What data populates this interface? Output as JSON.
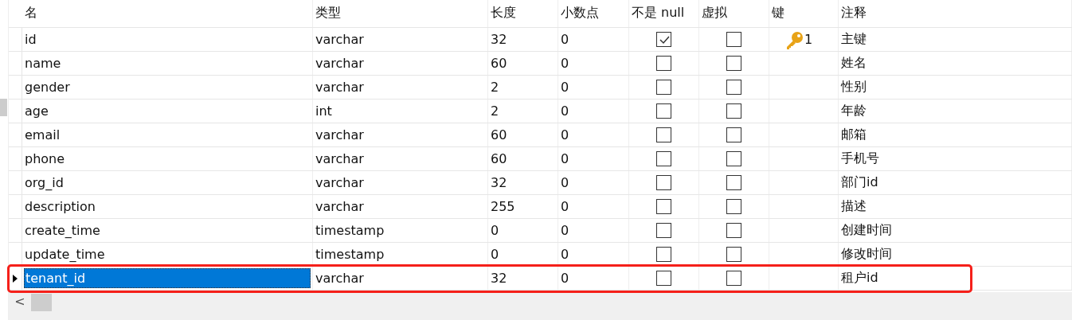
{
  "table": {
    "columns": [
      "名",
      "类型",
      "长度",
      "小数点",
      "不是 null",
      "虚拟",
      "键",
      "注释"
    ],
    "rows": [
      {
        "name": "id",
        "type": "varchar",
        "length": "32",
        "decimals": "0",
        "not_null": true,
        "virtual": false,
        "key": "1",
        "comment": "主键",
        "selected": false
      },
      {
        "name": "name",
        "type": "varchar",
        "length": "60",
        "decimals": "0",
        "not_null": false,
        "virtual": false,
        "comment": "姓名",
        "selected": false
      },
      {
        "name": "gender",
        "type": "varchar",
        "length": "2",
        "decimals": "0",
        "not_null": false,
        "virtual": false,
        "comment": "性别",
        "selected": false
      },
      {
        "name": "age",
        "type": "int",
        "length": "2",
        "decimals": "0",
        "not_null": false,
        "virtual": false,
        "comment": "年龄",
        "selected": false
      },
      {
        "name": "email",
        "type": "varchar",
        "length": "60",
        "decimals": "0",
        "not_null": false,
        "virtual": false,
        "comment": "邮箱",
        "selected": false
      },
      {
        "name": "phone",
        "type": "varchar",
        "length": "60",
        "decimals": "0",
        "not_null": false,
        "virtual": false,
        "comment": "手机号",
        "selected": false
      },
      {
        "name": "org_id",
        "type": "varchar",
        "length": "32",
        "decimals": "0",
        "not_null": false,
        "virtual": false,
        "comment": "部门id",
        "selected": false
      },
      {
        "name": "description",
        "type": "varchar",
        "length": "255",
        "decimals": "0",
        "not_null": false,
        "virtual": false,
        "comment": "描述",
        "selected": false
      },
      {
        "name": "create_time",
        "type": "timestamp",
        "length": "0",
        "decimals": "0",
        "not_null": false,
        "virtual": false,
        "comment": "创建时间",
        "selected": false
      },
      {
        "name": "update_time",
        "type": "timestamp",
        "length": "0",
        "decimals": "0",
        "not_null": false,
        "virtual": false,
        "comment": "修改时间",
        "selected": false
      },
      {
        "name": "tenant_id",
        "type": "varchar",
        "length": "32",
        "decimals": "0",
        "not_null": false,
        "virtual": false,
        "comment": "租户id",
        "selected": true,
        "highlighted": true
      }
    ]
  },
  "scrollbar": {
    "left_arrow": "<"
  }
}
